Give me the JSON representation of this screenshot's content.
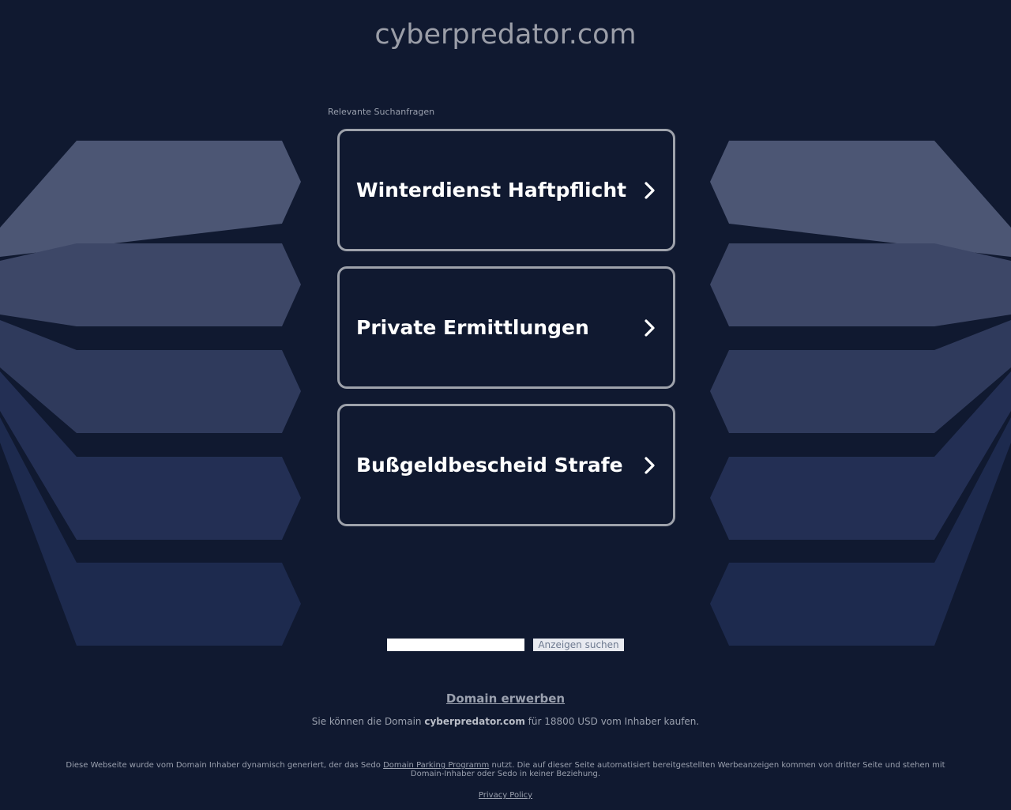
{
  "page": {
    "domain": "cyberpredator.com"
  },
  "related": {
    "label": "Relevante Suchanfragen",
    "items": [
      {
        "label": "Winterdienst Haftpflicht"
      },
      {
        "label": "Private Ermittlungen"
      },
      {
        "label": "Bußgeldbescheid Strafe"
      }
    ]
  },
  "search": {
    "input_value": "",
    "button_label": "Anzeigen suchen"
  },
  "sale": {
    "link_label": "Domain erwerben",
    "text_prefix": "Sie können die Domain ",
    "domain": "cyberpredator.com",
    "text_suffix": " für 18800 USD vom Inhaber kaufen."
  },
  "footer": {
    "disclaimer_prefix": "Diese Webseite wurde vom Domain Inhaber dynamisch generiert, der das Sedo ",
    "disclaimer_link": "Domain Parking Programm",
    "disclaimer_suffix": " nutzt. Die auf dieser Seite automatisiert bereitgestellten Werbeanzeigen kommen von dritter Seite und stehen mit Domain-Inhaber oder Sedo in keiner Beziehung.",
    "privacy_label": "Privacy Policy"
  },
  "colors": {
    "background": "#101930",
    "card_border": "#9ea2ab",
    "text_muted": "#9aa0ae"
  },
  "icons": {
    "card_arrow": "chevron-right-icon"
  }
}
